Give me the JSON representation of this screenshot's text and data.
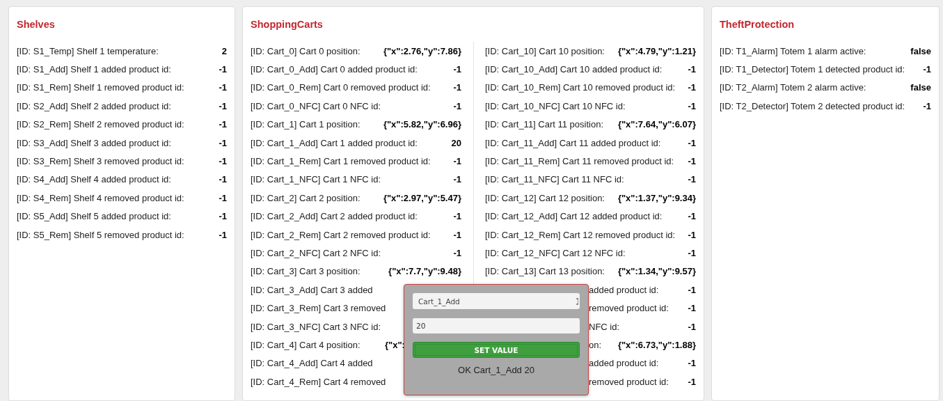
{
  "panels": [
    {
      "title": "Shelves",
      "columns": [
        [
          {
            "kind": "full",
            "label": "[ID: S1_Temp] Shelf 1 temperature:",
            "value": "2"
          },
          {
            "kind": "full",
            "label": "[ID: S1_Add] Shelf 1 added product id:",
            "value": "-1"
          },
          {
            "kind": "full",
            "label": "[ID: S1_Rem] Shelf 1 removed product id:",
            "value": "-1"
          },
          {
            "kind": "full",
            "label": "[ID: S2_Add] Shelf 2 added product id:",
            "value": "-1"
          },
          {
            "kind": "full",
            "label": "[ID: S2_Rem] Shelf 2 removed product id:",
            "value": "-1"
          },
          {
            "kind": "full",
            "label": "[ID: S3_Add] Shelf 3 added product id:",
            "value": "-1"
          },
          {
            "kind": "full",
            "label": "[ID: S3_Rem] Shelf 3 removed product id:",
            "value": "-1"
          },
          {
            "kind": "full",
            "label": "[ID: S4_Add] Shelf 4 added product id:",
            "value": "-1"
          },
          {
            "kind": "full",
            "label": "[ID: S4_Rem] Shelf 4 removed product id:",
            "value": "-1"
          },
          {
            "kind": "full",
            "label": "[ID: S5_Add] Shelf 5 added product id:",
            "value": "-1"
          },
          {
            "kind": "full",
            "label": "[ID: S5_Rem] Shelf 5 removed product id:",
            "value": "-1"
          }
        ]
      ]
    },
    {
      "title": "ShoppingCarts",
      "columns": [
        [
          {
            "kind": "full",
            "label": "[ID: Cart_0] Cart 0 position:",
            "value": "{\"x\":2.76,\"y\":7.86}"
          },
          {
            "kind": "full",
            "label": "[ID: Cart_0_Add] Cart 0 added product id:",
            "value": "-1"
          },
          {
            "kind": "full",
            "label": "[ID: Cart_0_Rem] Cart 0 removed product id:",
            "value": "-1"
          },
          {
            "kind": "full",
            "label": "[ID: Cart_0_NFC] Cart 0 NFC id:",
            "value": "-1"
          },
          {
            "kind": "full",
            "label": "[ID: Cart_1] Cart 1 position:",
            "value": "{\"x\":5.82,\"y\":6.96}"
          },
          {
            "kind": "full",
            "label": "[ID: Cart_1_Add] Cart 1 added product id:",
            "value": "20"
          },
          {
            "kind": "full",
            "label": "[ID: Cart_1_Rem] Cart 1 removed product id:",
            "value": "-1"
          },
          {
            "kind": "full",
            "label": "[ID: Cart_1_NFC] Cart 1 NFC id:",
            "value": "-1"
          },
          {
            "kind": "full",
            "label": "[ID: Cart_2] Cart 2 position:",
            "value": "{\"x\":2.97,\"y\":5.47}"
          },
          {
            "kind": "full",
            "label": "[ID: Cart_2_Add] Cart 2 added product id:",
            "value": "-1"
          },
          {
            "kind": "full",
            "label": "[ID: Cart_2_Rem] Cart 2 removed product id:",
            "value": "-1"
          },
          {
            "kind": "full",
            "label": "[ID: Cart_2_NFC] Cart 2 NFC id:",
            "value": "-1"
          },
          {
            "kind": "full",
            "label": "[ID: Cart_3] Cart 3 position:",
            "value": "{\"x\":7.7,\"y\":9.48}"
          },
          {
            "kind": "head",
            "label": "[ID: Cart_3_Add] Cart 3 added"
          },
          {
            "kind": "head",
            "label": "[ID: Cart_3_Rem] Cart 3 removed"
          },
          {
            "kind": "head",
            "label": "[ID: Cart_3_NFC] Cart 3 NFC id:"
          },
          {
            "kind": "head",
            "label": "[ID: Cart_4] Cart 4 position:",
            "value": "{\"x\":"
          },
          {
            "kind": "head",
            "label": "[ID: Cart_4_Add] Cart 4 added"
          },
          {
            "kind": "head",
            "label": "[ID: Cart_4_Rem] Cart 4 removed"
          }
        ],
        [
          {
            "kind": "full",
            "label": "[ID: Cart_10] Cart 10 position:",
            "value": "{\"x\":4.79,\"y\":1.21}"
          },
          {
            "kind": "full",
            "label": "[ID: Cart_10_Add] Cart 10 added product id:",
            "value": "-1"
          },
          {
            "kind": "full",
            "label": "[ID: Cart_10_Rem] Cart 10 removed product id:",
            "value": "-1"
          },
          {
            "kind": "full",
            "label": "[ID: Cart_10_NFC] Cart 10 NFC id:",
            "value": "-1"
          },
          {
            "kind": "full",
            "label": "[ID: Cart_11] Cart 11 position:",
            "value": "{\"x\":7.64,\"y\":6.07}"
          },
          {
            "kind": "full",
            "label": "[ID: Cart_11_Add] Cart 11 added product id:",
            "value": "-1"
          },
          {
            "kind": "full",
            "label": "[ID: Cart_11_Rem] Cart 11 removed product id:",
            "value": "-1"
          },
          {
            "kind": "full",
            "label": "[ID: Cart_11_NFC] Cart 11 NFC id:",
            "value": "-1"
          },
          {
            "kind": "full",
            "label": "[ID: Cart_12] Cart 12 position:",
            "value": "{\"x\":1.37,\"y\":9.34}"
          },
          {
            "kind": "full",
            "label": "[ID: Cart_12_Add] Cart 12 added product id:",
            "value": "-1"
          },
          {
            "kind": "full",
            "label": "[ID: Cart_12_Rem] Cart 12 removed product id:",
            "value": "-1"
          },
          {
            "kind": "full",
            "label": "[ID: Cart_12_NFC] Cart 12 NFC id:",
            "value": "-1"
          },
          {
            "kind": "full",
            "label": "[ID: Cart_13] Cart 13 position:",
            "value": "{\"x\":1.34,\"y\":9.57}"
          },
          {
            "kind": "tail",
            "label": "added product id:",
            "value": "-1"
          },
          {
            "kind": "tail",
            "label": "removed product id:",
            "value": "-1"
          },
          {
            "kind": "tail",
            "label": "NFC id:",
            "value": "-1"
          },
          {
            "kind": "tail",
            "label": "on:",
            "value": "{\"x\":6.73,\"y\":1.88}"
          },
          {
            "kind": "tail",
            "label": "added product id:",
            "value": "-1"
          },
          {
            "kind": "tail",
            "label": "removed product id:",
            "value": "-1"
          }
        ]
      ]
    },
    {
      "title": "TheftProtection",
      "columns": [
        [
          {
            "kind": "full",
            "label": "[ID: T1_Alarm] Totem 1 alarm active:",
            "value": "false"
          },
          {
            "kind": "full",
            "label": "[ID: T1_Detector] Totem 1 detected product id:",
            "value": "-1"
          },
          {
            "kind": "full",
            "label": "[ID: T2_Alarm] Totem 2 alarm active:",
            "value": "false"
          },
          {
            "kind": "full",
            "label": "[ID: T2_Detector] Totem 2 detected product id:",
            "value": "-1"
          }
        ]
      ]
    }
  ],
  "dialog": {
    "select": "Cart_1_Add",
    "input": "20",
    "button": "SET VALUE",
    "status": "OK Cart_1_Add 20"
  }
}
